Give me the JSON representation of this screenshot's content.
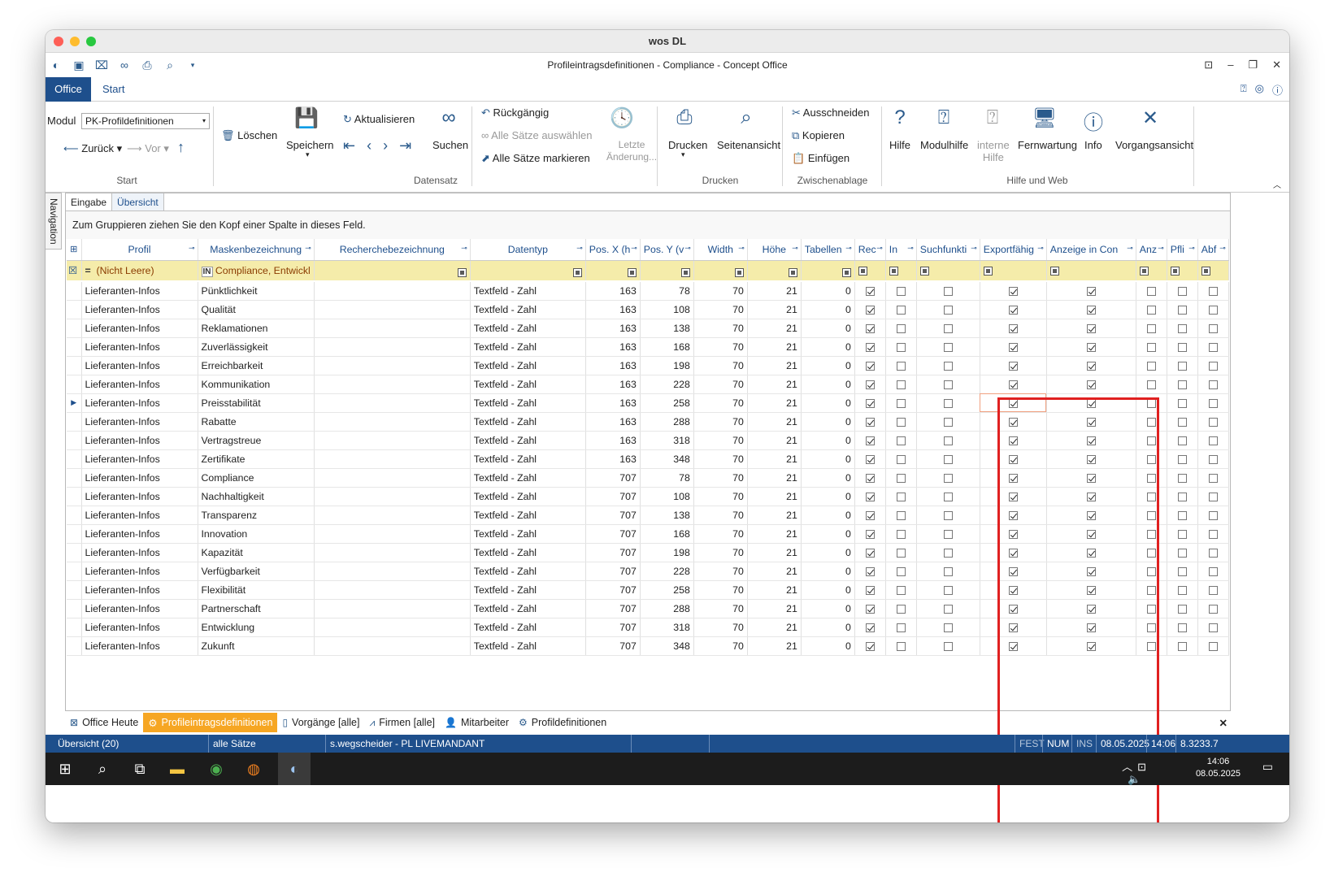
{
  "mac_title": "wos DL",
  "app_title": "Profileintragsdefinitionen - Compliance - Concept Office",
  "tabs": {
    "office": "Office",
    "start": "Start"
  },
  "ribbon": {
    "modul_label": "Modul",
    "modul_value": "PK-Profildefinitionen",
    "zurueck": "Zurück",
    "vor": "Vor",
    "loeschen": "Löschen",
    "speichern": "Speichern",
    "aktualisieren": "Aktualisieren",
    "suchen": "Suchen",
    "rueckgaengig": "Rückgängig",
    "alle_saetze_auswaehlen": "Alle Sätze auswählen",
    "alle_saetze_markieren": "Alle Sätze markieren",
    "letzte": "Letzte",
    "aenderung": "Änderung...",
    "drucken": "Drucken",
    "seitenansicht": "Seitenansicht",
    "ausschneiden": "Ausschneiden",
    "kopieren": "Kopieren",
    "einfuegen": "Einfügen",
    "hilfe": "Hilfe",
    "modulhilfe": "Modulhilfe",
    "interne": "interne",
    "interne_hilfe": "Hilfe",
    "fernwartung": "Fernwartung",
    "info": "Info",
    "vorgangsansicht": "Vorgangsansicht",
    "groups": {
      "start": "Start",
      "datensatz": "Datensatz",
      "drucken": "Drucken",
      "zwischenablage": "Zwischenablage",
      "hilfe": "Hilfe und Web"
    }
  },
  "navigation_label": "Navigation",
  "subtabs": [
    "Eingabe",
    "Übersicht"
  ],
  "group_hint": "Zum Gruppieren ziehen Sie den Kopf einer Spalte in dieses Feld.",
  "columns": [
    "Profil",
    "Maskenbezeichnung",
    "Recherchebezeichnung",
    "Datentyp",
    "Pos. X (h",
    "Pos. Y (v",
    "Width",
    "Höhe",
    "Tabellen",
    "Rec",
    "In",
    "Suchfunkti",
    "Exportfähig",
    "Anzeige in Con",
    "Anz",
    "Pfli",
    "Abf"
  ],
  "filter": {
    "op": "=",
    "profil": "(Nicht Leere)",
    "in": "IN",
    "maske": "Compliance, Entwickl"
  },
  "rows": [
    {
      "profil": "Lieferanten-Infos",
      "maske": "Pünktlichkeit",
      "typ": "Textfeld - Zahl",
      "x": "163",
      "y": "78",
      "w": "70",
      "h": "21",
      "tab": "0"
    },
    {
      "profil": "Lieferanten-Infos",
      "maske": "Qualität",
      "typ": "Textfeld - Zahl",
      "x": "163",
      "y": "108",
      "w": "70",
      "h": "21",
      "tab": "0"
    },
    {
      "profil": "Lieferanten-Infos",
      "maske": "Reklamationen",
      "typ": "Textfeld - Zahl",
      "x": "163",
      "y": "138",
      "w": "70",
      "h": "21",
      "tab": "0"
    },
    {
      "profil": "Lieferanten-Infos",
      "maske": "Zuverlässigkeit",
      "typ": "Textfeld - Zahl",
      "x": "163",
      "y": "168",
      "w": "70",
      "h": "21",
      "tab": "0"
    },
    {
      "profil": "Lieferanten-Infos",
      "maske": "Erreichbarkeit",
      "typ": "Textfeld - Zahl",
      "x": "163",
      "y": "198",
      "w": "70",
      "h": "21",
      "tab": "0"
    },
    {
      "profil": "Lieferanten-Infos",
      "maske": "Kommunikation",
      "typ": "Textfeld - Zahl",
      "x": "163",
      "y": "228",
      "w": "70",
      "h": "21",
      "tab": "0"
    },
    {
      "profil": "Lieferanten-Infos",
      "maske": "Preisstabilität",
      "typ": "Textfeld - Zahl",
      "x": "163",
      "y": "258",
      "w": "70",
      "h": "21",
      "tab": "0"
    },
    {
      "profil": "Lieferanten-Infos",
      "maske": "Rabatte",
      "typ": "Textfeld - Zahl",
      "x": "163",
      "y": "288",
      "w": "70",
      "h": "21",
      "tab": "0"
    },
    {
      "profil": "Lieferanten-Infos",
      "maske": "Vertragstreue",
      "typ": "Textfeld - Zahl",
      "x": "163",
      "y": "318",
      "w": "70",
      "h": "21",
      "tab": "0"
    },
    {
      "profil": "Lieferanten-Infos",
      "maske": "Zertifikate",
      "typ": "Textfeld - Zahl",
      "x": "163",
      "y": "348",
      "w": "70",
      "h": "21",
      "tab": "0"
    },
    {
      "profil": "Lieferanten-Infos",
      "maske": "Compliance",
      "typ": "Textfeld - Zahl",
      "x": "707",
      "y": "78",
      "w": "70",
      "h": "21",
      "tab": "0"
    },
    {
      "profil": "Lieferanten-Infos",
      "maske": "Nachhaltigkeit",
      "typ": "Textfeld - Zahl",
      "x": "707",
      "y": "108",
      "w": "70",
      "h": "21",
      "tab": "0"
    },
    {
      "profil": "Lieferanten-Infos",
      "maske": "Transparenz",
      "typ": "Textfeld - Zahl",
      "x": "707",
      "y": "138",
      "w": "70",
      "h": "21",
      "tab": "0"
    },
    {
      "profil": "Lieferanten-Infos",
      "maske": "Innovation",
      "typ": "Textfeld - Zahl",
      "x": "707",
      "y": "168",
      "w": "70",
      "h": "21",
      "tab": "0"
    },
    {
      "profil": "Lieferanten-Infos",
      "maske": "Kapazität",
      "typ": "Textfeld - Zahl",
      "x": "707",
      "y": "198",
      "w": "70",
      "h": "21",
      "tab": "0"
    },
    {
      "profil": "Lieferanten-Infos",
      "maske": "Verfügbarkeit",
      "typ": "Textfeld - Zahl",
      "x": "707",
      "y": "228",
      "w": "70",
      "h": "21",
      "tab": "0"
    },
    {
      "profil": "Lieferanten-Infos",
      "maske": "Flexibilität",
      "typ": "Textfeld - Zahl",
      "x": "707",
      "y": "258",
      "w": "70",
      "h": "21",
      "tab": "0"
    },
    {
      "profil": "Lieferanten-Infos",
      "maske": "Partnerschaft",
      "typ": "Textfeld - Zahl",
      "x": "707",
      "y": "288",
      "w": "70",
      "h": "21",
      "tab": "0"
    },
    {
      "profil": "Lieferanten-Infos",
      "maske": "Entwicklung",
      "typ": "Textfeld - Zahl",
      "x": "707",
      "y": "318",
      "w": "70",
      "h": "21",
      "tab": "0"
    },
    {
      "profil": "Lieferanten-Infos",
      "maske": "Zukunft",
      "typ": "Textfeld - Zahl",
      "x": "707",
      "y": "348",
      "w": "70",
      "h": "21",
      "tab": "0"
    }
  ],
  "row_flags": {
    "rec": true,
    "in": false,
    "such": false,
    "export": true,
    "anzeige": true,
    "anz": false,
    "pfli": false,
    "abf": false
  },
  "current_row_index": 6,
  "bottom_tabs": [
    "Office Heute",
    "Profileintragsdefinitionen",
    "Vorgänge [alle]",
    "Firmen [alle]",
    "Mitarbeiter",
    "Profildefinitionen"
  ],
  "status": {
    "uebersicht": "Übersicht (20)",
    "saetze": "alle Sätze",
    "user": "s.wegscheider - PL LIVEMANDANT",
    "fest": "FEST",
    "num": "NUM",
    "ins": "INS",
    "date": "08.05.2025",
    "time": "14:06",
    "version": "8.3233.7"
  },
  "taskbar": {
    "time": "14:06",
    "date": "08.05.2025"
  },
  "colors": {
    "accent": "#1e4f8c",
    "active_tab": "#f6a623",
    "filter_row": "#f5ecaa",
    "highlight": "#e02020"
  }
}
